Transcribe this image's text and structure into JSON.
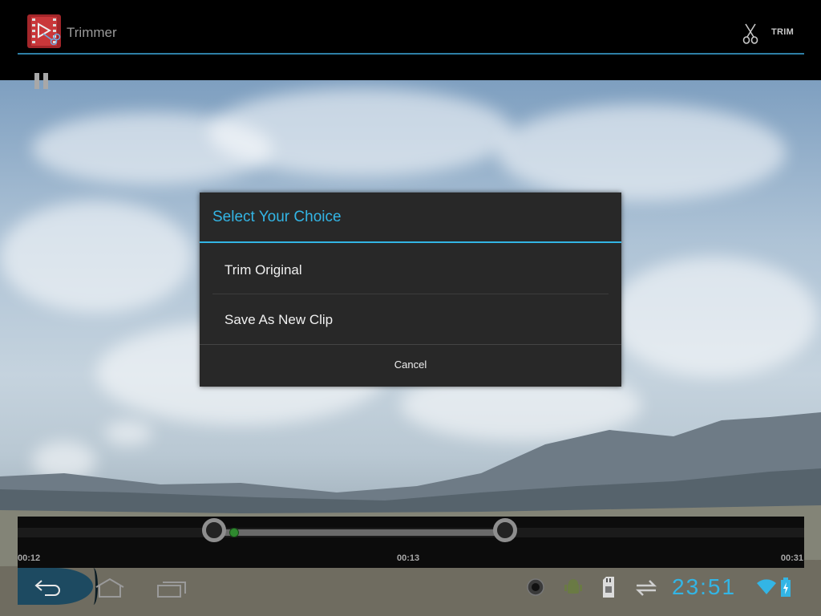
{
  "app": {
    "title": "Trimmer",
    "trim_label": "TRIM",
    "icons": {
      "app": "video-scissors-icon",
      "trim": "scissors-icon",
      "pause": "pause-icon"
    }
  },
  "dialog": {
    "title": "Select Your Choice",
    "items": [
      {
        "label": "Trim Original"
      },
      {
        "label": "Save As New Clip"
      }
    ],
    "cancel_label": "Cancel"
  },
  "timeline": {
    "start_time": "00:12",
    "current_time": "00:13",
    "end_time": "00:31",
    "trim_start_fraction": 0.25,
    "trim_end_fraction": 0.62,
    "playhead_fraction": 0.275
  },
  "status_bar": {
    "clock": "23:51",
    "icons": [
      "back-icon",
      "home-icon",
      "recent-apps-icon",
      "camera-icon",
      "android-debug-icon",
      "sd-card-icon",
      "sync-icon",
      "wifi-icon",
      "battery-icon"
    ]
  },
  "colors": {
    "accent": "#33b5e5",
    "dialog_bg": "#282828",
    "back_button_bg": "#1d4a61"
  }
}
